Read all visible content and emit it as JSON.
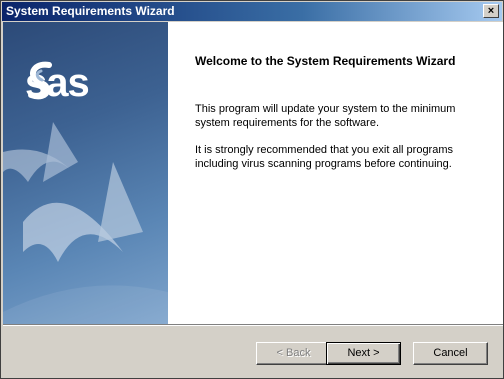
{
  "window": {
    "title": "System Requirements Wizard",
    "close_label": "×"
  },
  "banner": {
    "logo_text": "sas",
    "logo_icon": "sas-swirl-icon",
    "colors": {
      "dark": "#2c4a78",
      "light": "#7ea4cc"
    }
  },
  "content": {
    "heading": "Welcome to the System Requirements Wizard",
    "paragraph1": "This program will update your system to the minimum system requirements for the software.",
    "paragraph2": "It is strongly recommended that you exit all programs including virus scanning programs before continuing."
  },
  "buttons": {
    "back": "< Back",
    "next": "Next >",
    "cancel": "Cancel"
  }
}
